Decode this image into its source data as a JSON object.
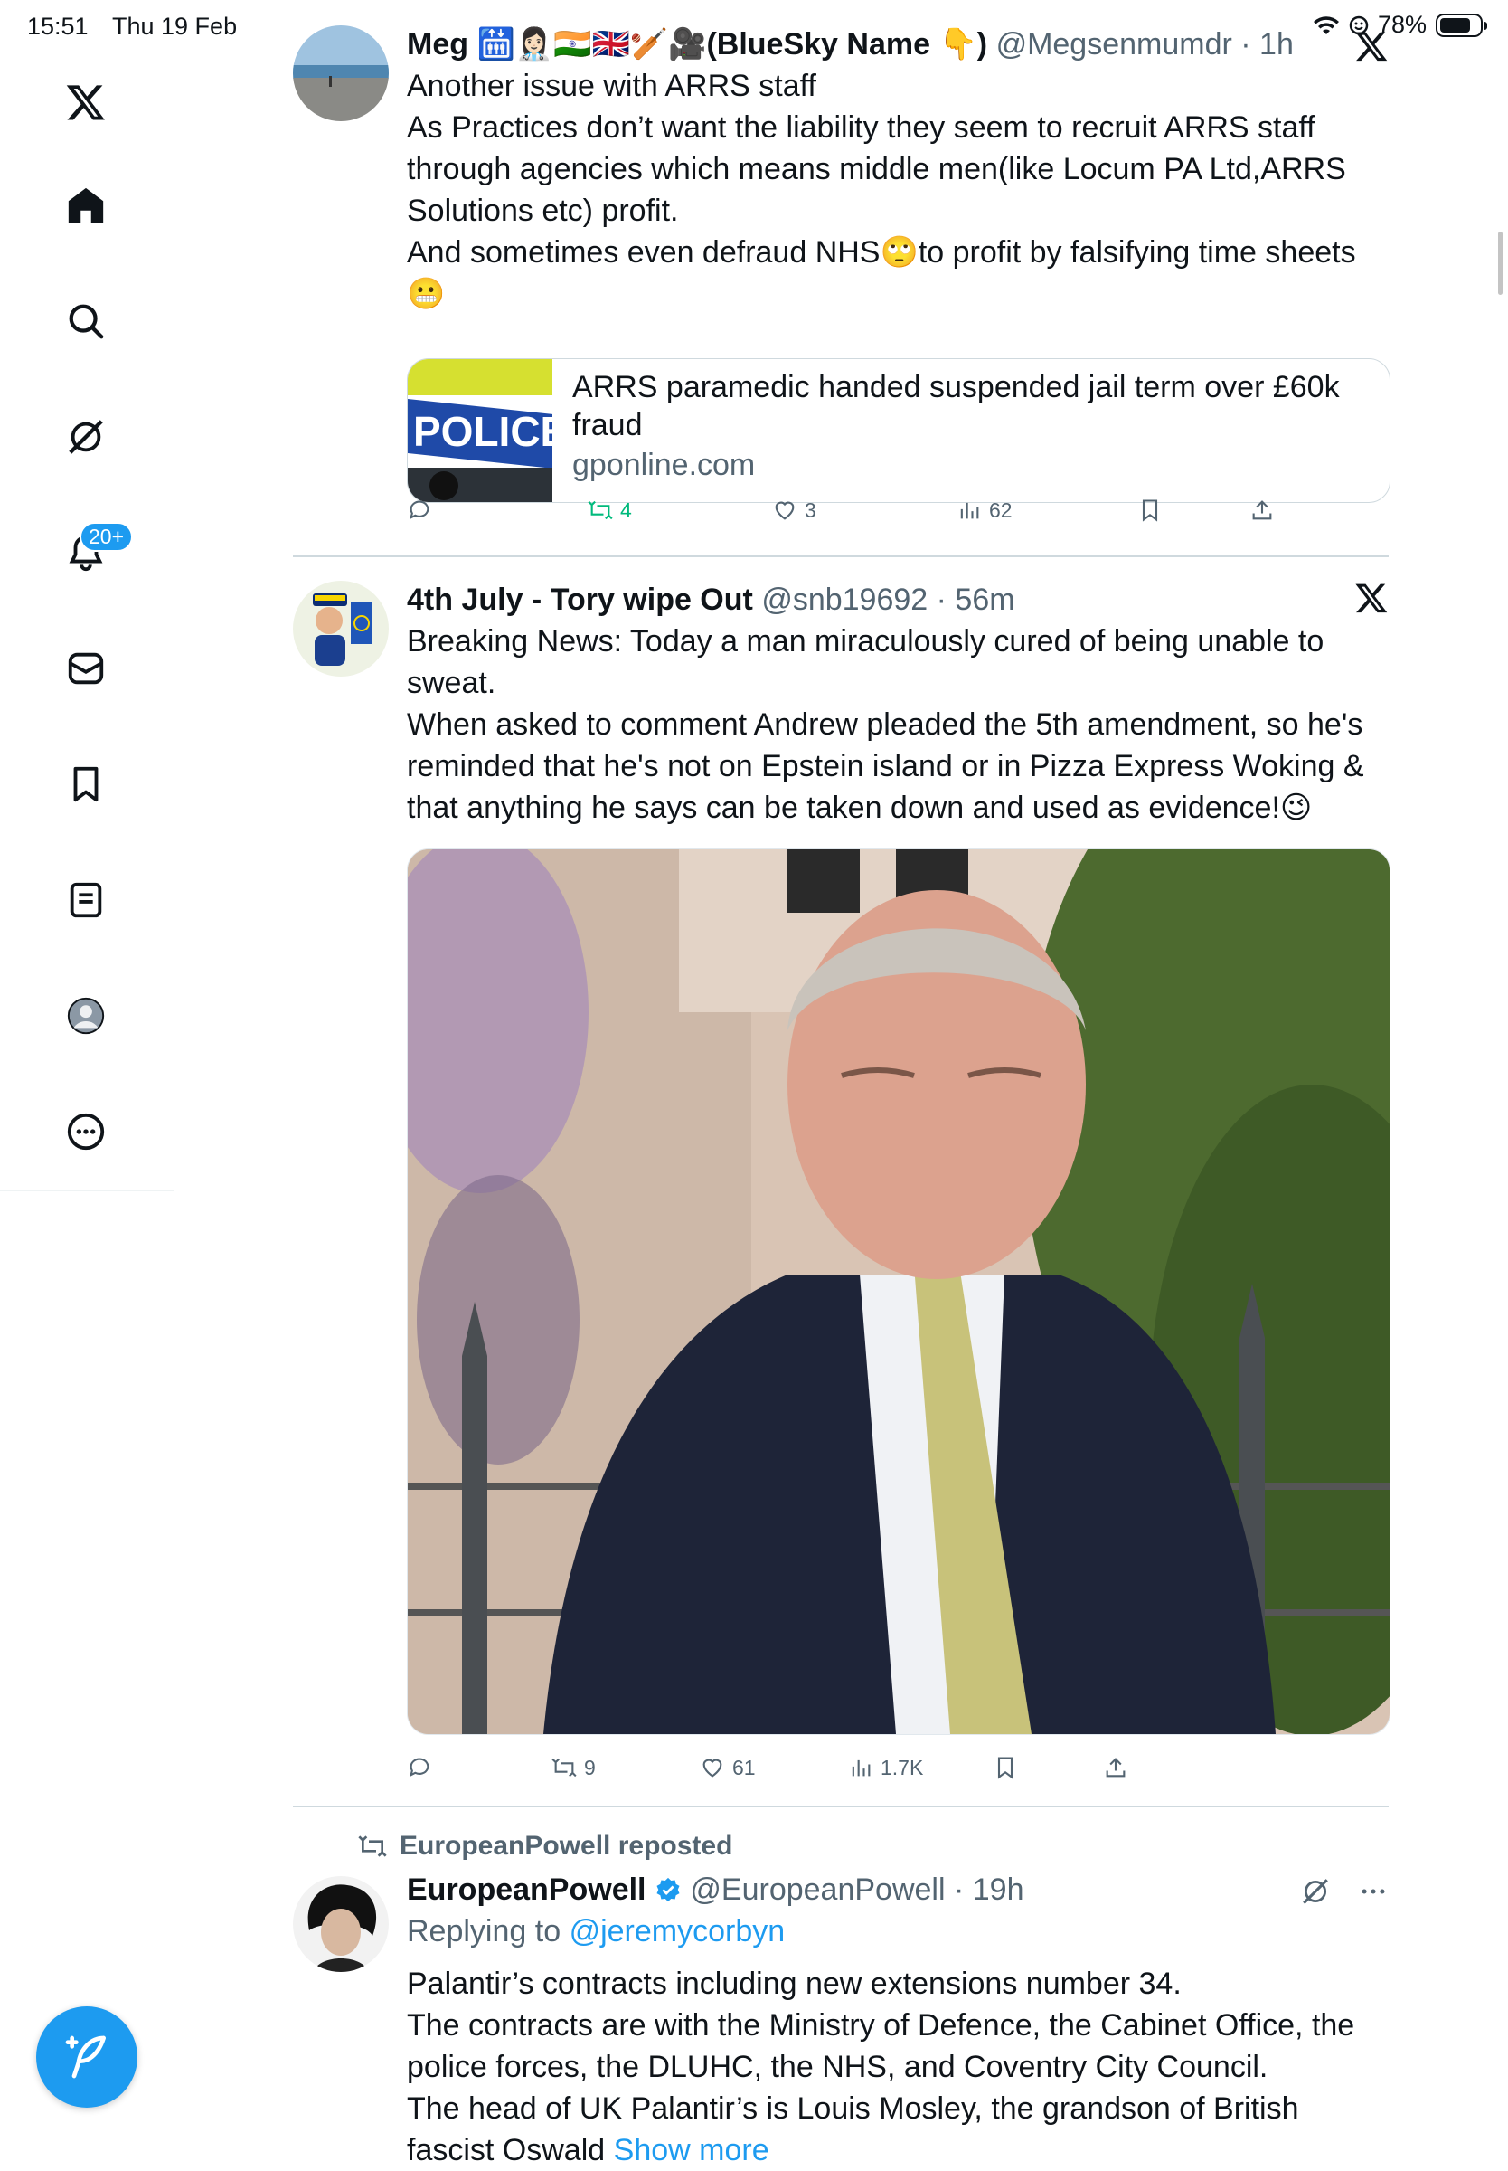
{
  "status_bar": {
    "time": "15:51",
    "date": "Thu 19 Feb",
    "battery": "78%",
    "battery_level": 0.78
  },
  "sidebar": {
    "notifications_badge": "20+",
    "items": [
      "x-logo",
      "home",
      "search",
      "grok",
      "notifications",
      "messages",
      "bookmarks",
      "lists",
      "profile",
      "more"
    ]
  },
  "tweets": [
    {
      "name": "Meg 🛗👩🏻‍⚕️🇮🇳🇬🇧🏏🎥(BlueSky Name 👇)",
      "handle": "@Megsenmumdr",
      "time": "1h",
      "body": [
        "Another issue with ARRS staff",
        "As Practices don’t want the liability they seem to recruit ARRS staff through agencies which means middle men(like Locum PA Ltd,ARRS Solutions etc) profit.",
        "And sometimes even defraud NHS🙄to profit by falsifying time sheets 😬"
      ],
      "card": {
        "title": "ARRS paramedic handed suspended jail term over £60k fraud",
        "domain": "gponline.com",
        "thumb_text": "POLICE"
      },
      "actions": {
        "replies": "",
        "reposts": "4",
        "likes": "3",
        "views": "62"
      }
    },
    {
      "name": "4th July - Tory wipe Out",
      "handle": "@snb19692",
      "time": "56m",
      "body": [
        "Breaking News: Today a man miraculously cured of being unable to sweat.",
        "When asked to comment Andrew pleaded the 5th amendment, so he's reminded that he's not on Epstein island or in Pizza Express Woking & that anything he says can be taken down and used as evidence!😉"
      ],
      "actions": {
        "replies": "",
        "reposts": "9",
        "likes": "61",
        "views": "1.7K"
      }
    },
    {
      "repost_label": "EuropeanPowell reposted",
      "name": "EuropeanPowell",
      "handle": "@EuropeanPowell",
      "time": "19h",
      "replying_prefix": "Replying to",
      "replying_to": "@jeremycorbyn",
      "body": [
        "Palantir’s contracts including new extensions number 34.",
        "The contracts are with the Ministry of Defence, the Cabinet Office, the police forces, the DLUHC, the NHS, and Coventry City Council.",
        "The head of UK Palantir’s is Louis Mosley, the grandson of British fascist Oswald"
      ],
      "show_more": "Show more"
    }
  ]
}
